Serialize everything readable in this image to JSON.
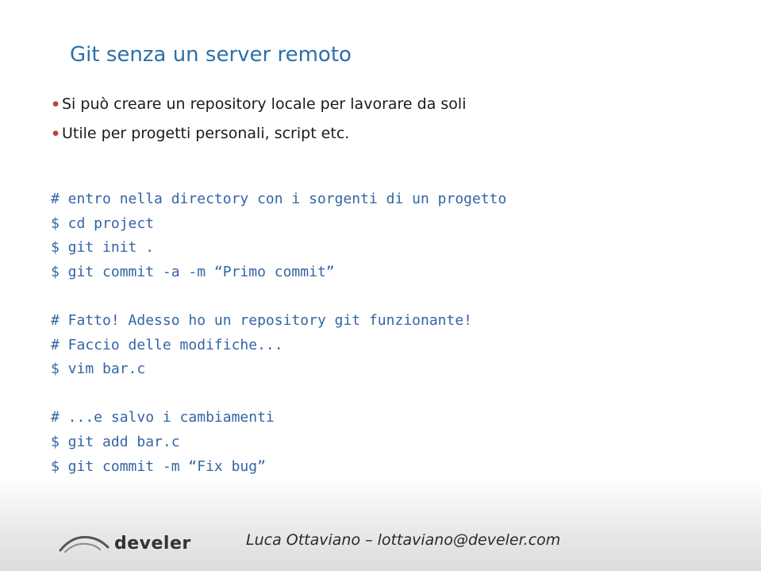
{
  "title": "Git senza un server remoto",
  "bullets": [
    "Si può creare un repository locale per lavorare da soli",
    "Utile per progetti personali, script etc."
  ],
  "code": "# entro nella directory con i sorgenti di un progetto\n$ cd project\n$ git init .\n$ git commit -a -m “Primo commit”\n\n# Fatto! Adesso ho un repository git funzionante!\n# Faccio delle modifiche...\n$ vim bar.c\n\n# ...e salvo i cambiamenti\n$ git add bar.c\n$ git commit -m “Fix bug”",
  "logo_text": "develer",
  "footer": "Luca Ottaviano – lottaviano@develer.com"
}
